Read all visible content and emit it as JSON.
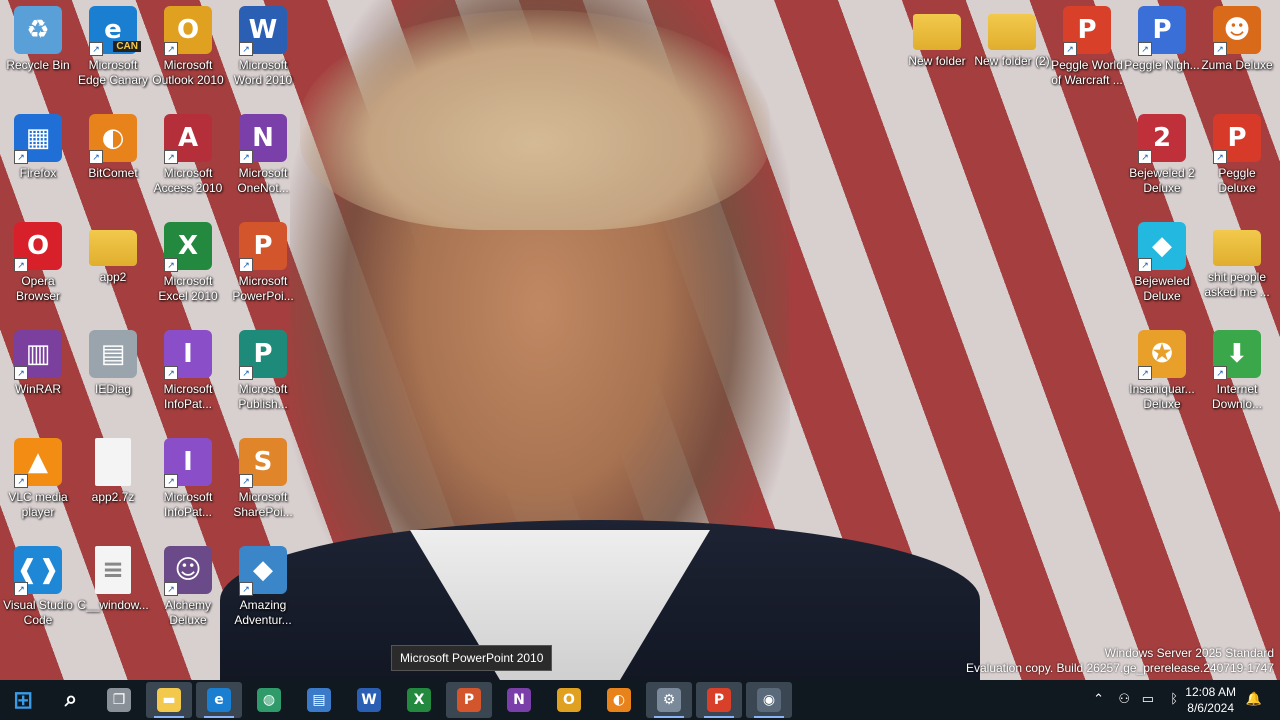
{
  "desktop": {
    "left_icons": [
      {
        "label": "Recycle Bin",
        "icon": "recycle-bin-icon",
        "color": "#5aa0d8",
        "glyph": "♻",
        "col": 0,
        "row": 0,
        "shortcut": false
      },
      {
        "label": "Microsoft Edge Canary",
        "icon": "edge-canary-icon",
        "color": "#1a7fd1",
        "glyph": "e",
        "col": 1,
        "row": 0,
        "shortcut": true
      },
      {
        "label": "Microsoft Outlook 2010",
        "icon": "outlook-icon",
        "color": "#e0a020",
        "glyph": "O",
        "col": 2,
        "row": 0,
        "shortcut": true
      },
      {
        "label": "Microsoft Word 2010",
        "icon": "word-icon",
        "color": "#2b5fb3",
        "glyph": "W",
        "col": 3,
        "row": 0,
        "shortcut": true
      },
      {
        "label": "Firefox",
        "icon": "firefox-icon",
        "color": "#1f6fd6",
        "glyph": "▦",
        "col": 0,
        "row": 1,
        "shortcut": true
      },
      {
        "label": "BitComet",
        "icon": "bitcomet-icon",
        "color": "#e8821a",
        "glyph": "◐",
        "col": 1,
        "row": 1,
        "shortcut": true
      },
      {
        "label": "Microsoft Access 2010",
        "icon": "access-icon",
        "color": "#b42f3a",
        "glyph": "A",
        "col": 2,
        "row": 1,
        "shortcut": true
      },
      {
        "label": "Microsoft OneNot...",
        "icon": "onenote-icon",
        "color": "#7a3fa8",
        "glyph": "N",
        "col": 3,
        "row": 1,
        "shortcut": true
      },
      {
        "label": "Opera Browser",
        "icon": "opera-icon",
        "color": "#d8202a",
        "glyph": "O",
        "col": 0,
        "row": 2,
        "shortcut": true
      },
      {
        "label": "app2",
        "icon": "folder-icon",
        "color": "#f2c94c",
        "glyph": "",
        "col": 1,
        "row": 2,
        "shortcut": false
      },
      {
        "label": "Microsoft Excel 2010",
        "icon": "excel-icon",
        "color": "#23893f",
        "glyph": "X",
        "col": 2,
        "row": 2,
        "shortcut": true
      },
      {
        "label": "Microsoft PowerPoi...",
        "icon": "powerpoint-icon",
        "color": "#d2552c",
        "glyph": "P",
        "col": 3,
        "row": 2,
        "shortcut": true
      },
      {
        "label": "WinRAR",
        "icon": "winrar-icon",
        "color": "#7b3f9e",
        "glyph": "▥",
        "col": 0,
        "row": 3,
        "shortcut": true
      },
      {
        "label": "IEDiag",
        "icon": "iediag-icon",
        "color": "#9aa4ad",
        "glyph": "▤",
        "col": 1,
        "row": 3,
        "shortcut": false
      },
      {
        "label": "Microsoft InfoPat...",
        "icon": "infopath-icon",
        "color": "#8a4fc8",
        "glyph": "I",
        "col": 2,
        "row": 3,
        "shortcut": true
      },
      {
        "label": "Microsoft Publish...",
        "icon": "publisher-icon",
        "color": "#1e8a7a",
        "glyph": "P",
        "col": 3,
        "row": 3,
        "shortcut": true
      },
      {
        "label": "VLC media player",
        "icon": "vlc-icon",
        "color": "#f28c12",
        "glyph": "▲",
        "col": 0,
        "row": 4,
        "shortcut": true
      },
      {
        "label": "app2.7z",
        "icon": "file-icon",
        "color": "#f4f4f4",
        "glyph": "",
        "col": 1,
        "row": 4,
        "shortcut": false
      },
      {
        "label": "Microsoft InfoPat...",
        "icon": "infopath-icon",
        "color": "#8a4fc8",
        "glyph": "I",
        "col": 2,
        "row": 4,
        "shortcut": true
      },
      {
        "label": "Microsoft SharePoi...",
        "icon": "sharepoint-icon",
        "color": "#e0852a",
        "glyph": "S",
        "col": 3,
        "row": 4,
        "shortcut": true
      },
      {
        "label": "Visual Studio Code",
        "icon": "vscode-icon",
        "color": "#1e88d6",
        "glyph": "❰❱",
        "col": 0,
        "row": 5,
        "shortcut": true
      },
      {
        "label": "C__window...",
        "icon": "text-file-icon",
        "color": "#f4f4f4",
        "glyph": "≡",
        "col": 1,
        "row": 5,
        "shortcut": false
      },
      {
        "label": "Alchemy Deluxe",
        "icon": "alchemy-icon",
        "color": "#6b4a8a",
        "glyph": "☺",
        "col": 2,
        "row": 5,
        "shortcut": true
      },
      {
        "label": "Amazing Adventur...",
        "icon": "amazing-adventures-icon",
        "color": "#3a86c8",
        "glyph": "◆",
        "col": 3,
        "row": 5,
        "shortcut": true
      }
    ],
    "right_icons": [
      {
        "label": "New folder",
        "icon": "folder-icon",
        "color": "#f2c94c",
        "glyph": "",
        "col": 0,
        "row": 0,
        "shortcut": false
      },
      {
        "label": "New folder (2)",
        "icon": "folder-icon",
        "color": "#f2c94c",
        "glyph": "",
        "col": 1,
        "row": 0,
        "shortcut": false
      },
      {
        "label": "Peggle World of Warcraft ...",
        "icon": "peggle-wow-icon",
        "color": "#d8402a",
        "glyph": "P",
        "col": 2,
        "row": 0,
        "shortcut": true
      },
      {
        "label": "Peggle Nigh...",
        "icon": "peggle-nights-icon",
        "color": "#3a6fd8",
        "glyph": "P",
        "col": 3,
        "row": 0,
        "shortcut": true
      },
      {
        "label": "Zuma Deluxe",
        "icon": "zuma-icon",
        "color": "#d86a1a",
        "glyph": "☻",
        "col": 4,
        "row": 0,
        "shortcut": true
      },
      {
        "label": "Bejeweled 2 Deluxe",
        "icon": "bejeweled2-icon",
        "color": "#c0303a",
        "glyph": "2",
        "col": 3,
        "row": 1,
        "shortcut": true
      },
      {
        "label": "Peggle Deluxe",
        "icon": "peggle-deluxe-icon",
        "color": "#d83a2a",
        "glyph": "P",
        "col": 4,
        "row": 1,
        "shortcut": true
      },
      {
        "label": "Bejeweled Deluxe",
        "icon": "bejeweled-icon",
        "color": "#22b8e0",
        "glyph": "◆",
        "col": 3,
        "row": 2,
        "shortcut": true
      },
      {
        "label": "shit people asked me ...",
        "icon": "folder-icon",
        "color": "#f2c94c",
        "glyph": "",
        "col": 4,
        "row": 2,
        "shortcut": false
      },
      {
        "label": "Insaniquar... Deluxe",
        "icon": "insaniquarium-icon",
        "color": "#e8a02a",
        "glyph": "✪",
        "col": 3,
        "row": 3,
        "shortcut": true
      },
      {
        "label": "Internet Downlo...",
        "icon": "internet-download-manager-icon",
        "color": "#3aa84a",
        "glyph": "⬇",
        "col": 4,
        "row": 3,
        "shortcut": true
      }
    ],
    "edge_badge": "CAN"
  },
  "tooltip": {
    "text": "Microsoft PowerPoint 2010"
  },
  "watermark": {
    "line1": "Windows Server 2025 Standard",
    "line2": "Evaluation copy. Build 26257.ge_prerelease.240719-1747"
  },
  "taskbar": {
    "buttons": [
      {
        "name": "start-button",
        "icon": "windows-logo-icon",
        "color": "#3a9be8",
        "glyph": "⊞",
        "running": false,
        "active": false
      },
      {
        "name": "search-button",
        "icon": "search-icon",
        "color": "transparent",
        "glyph": "⌕",
        "running": false,
        "active": false
      },
      {
        "name": "task-view-button",
        "icon": "task-view-icon",
        "color": "#8a9098",
        "glyph": "❐",
        "running": false,
        "active": false
      },
      {
        "name": "file-explorer-button",
        "icon": "file-explorer-icon",
        "color": "#f2c94c",
        "glyph": "▬",
        "running": true,
        "active": true
      },
      {
        "name": "edge-canary-button",
        "icon": "edge-canary-icon",
        "color": "#1a7fd1",
        "glyph": "e",
        "running": true,
        "active": true
      },
      {
        "name": "internet-explorer-button",
        "icon": "globe-icon",
        "color": "#2f9a6a",
        "glyph": "◍",
        "running": false,
        "active": false
      },
      {
        "name": "network-button",
        "icon": "network-icon",
        "color": "#3a7ac8",
        "glyph": "▤",
        "running": false,
        "active": false
      },
      {
        "name": "word-button",
        "icon": "word-icon",
        "color": "#2b5fb3",
        "glyph": "W",
        "running": false,
        "active": false
      },
      {
        "name": "excel-button",
        "icon": "excel-icon",
        "color": "#23893f",
        "glyph": "X",
        "running": false,
        "active": false
      },
      {
        "name": "powerpoint-button",
        "icon": "powerpoint-icon",
        "color": "#d2552c",
        "glyph": "P",
        "running": false,
        "active": true
      },
      {
        "name": "onenote-button",
        "icon": "onenote-icon",
        "color": "#7a3fa8",
        "glyph": "N",
        "running": false,
        "active": false
      },
      {
        "name": "outlook-button",
        "icon": "outlook-icon",
        "color": "#e0a020",
        "glyph": "O",
        "running": false,
        "active": false
      },
      {
        "name": "bitcomet-button",
        "icon": "bitcomet-icon",
        "color": "#e8821a",
        "glyph": "◐",
        "running": false,
        "active": false
      },
      {
        "name": "control-panel-button",
        "icon": "control-panel-icon",
        "color": "#7a8a9a",
        "glyph": "⚙",
        "running": true,
        "active": true
      },
      {
        "name": "peggle-button",
        "icon": "peggle-icon",
        "color": "#d8402a",
        "glyph": "P",
        "running": true,
        "active": true
      },
      {
        "name": "settings-button",
        "icon": "settings-icon",
        "color": "#5a6a7a",
        "glyph": "◉",
        "running": true,
        "active": true
      }
    ],
    "tray": {
      "overflow": "⌃",
      "clock_time": "12:08 AM",
      "clock_date": "8/6/2024",
      "notification": "🔔"
    }
  }
}
